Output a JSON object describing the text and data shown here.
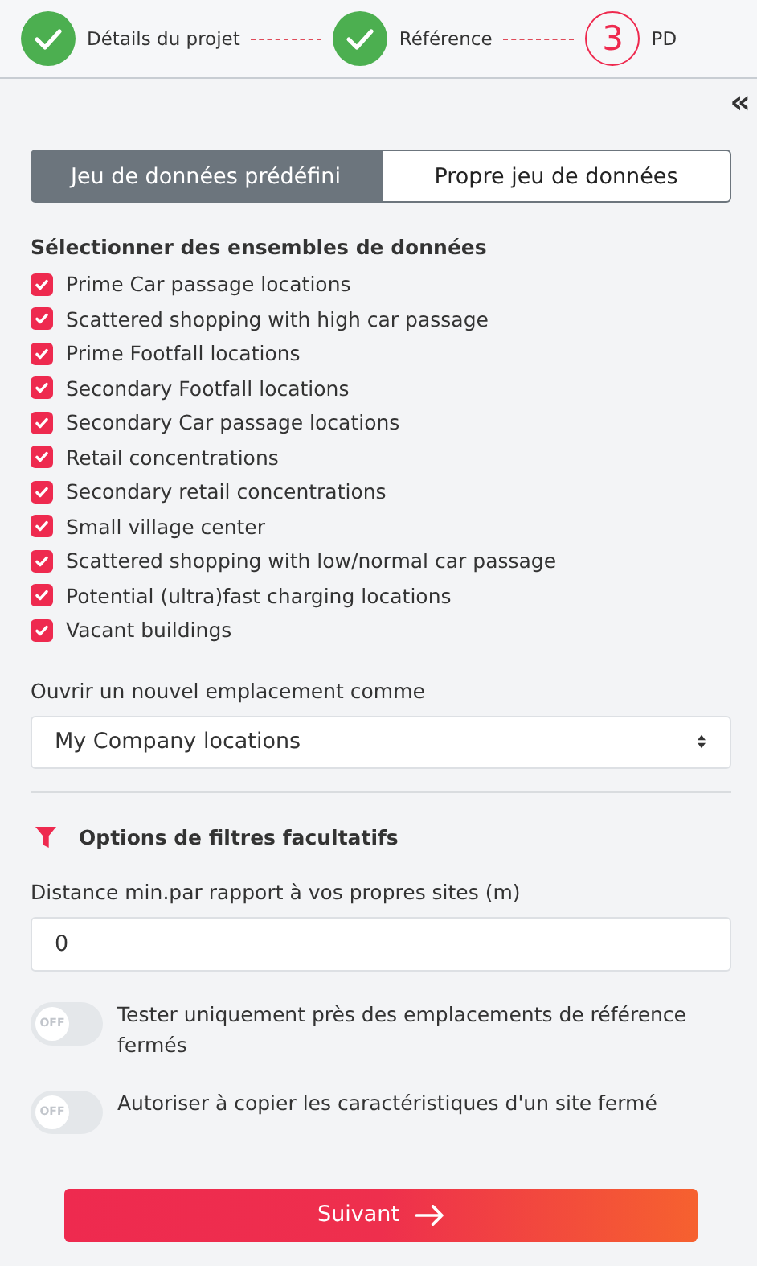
{
  "steps": [
    {
      "kind": "done",
      "label": "Détails du projet"
    },
    {
      "kind": "done",
      "label": "Référence"
    },
    {
      "kind": "current",
      "number": "3",
      "label": "PD"
    }
  ],
  "collapse_icon": "«",
  "tabs": [
    {
      "label": "Jeu de données prédéfini",
      "selected": true
    },
    {
      "label": "Propre jeu de données",
      "selected": false
    }
  ],
  "datasets": {
    "title": "Sélectionner des ensembles de données",
    "items": [
      {
        "label": "Prime Car passage locations",
        "checked": true
      },
      {
        "label": "Scattered shopping with high car passage",
        "checked": true
      },
      {
        "label": "Prime Footfall locations",
        "checked": true
      },
      {
        "label": "Secondary Footfall locations",
        "checked": true
      },
      {
        "label": "Secondary Car passage locations",
        "checked": true
      },
      {
        "label": "Retail concentrations",
        "checked": true
      },
      {
        "label": "Secondary retail concentrations",
        "checked": true
      },
      {
        "label": "Small village center",
        "checked": true
      },
      {
        "label": "Scattered shopping with low/normal car passage",
        "checked": true
      },
      {
        "label": "Potential (ultra)fast charging locations",
        "checked": true
      },
      {
        "label": "Vacant buildings",
        "checked": true
      }
    ]
  },
  "open_as": {
    "label": "Ouvrir un nouvel emplacement comme",
    "value": "My Company locations"
  },
  "filters": {
    "title": "Options de filtres facultatifs",
    "distance": {
      "label": "Distance min.par rapport à vos propres sites (m)",
      "value": "0"
    },
    "toggles": [
      {
        "label": "Tester uniquement près des emplacements de référence fermés",
        "on": false,
        "state_label": "OFF"
      },
      {
        "label": "Autoriser à copier les caractéristiques d'un site fermé",
        "on": false,
        "state_label": "OFF"
      }
    ]
  },
  "next_button": "Suivant"
}
